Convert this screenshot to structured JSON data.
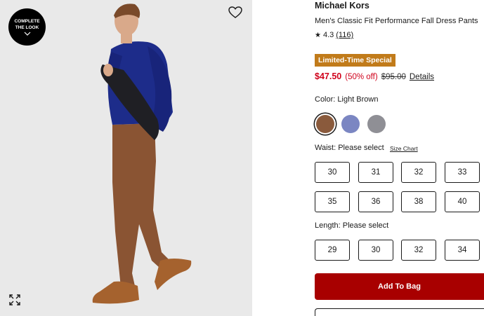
{
  "image": {
    "badge_line1": "COMPLETE",
    "badge_line2": "THE LOOK",
    "icons": [
      "chevron-down-icon",
      "heart-icon",
      "expand-icon"
    ]
  },
  "product": {
    "brand": "Michael Kors",
    "title": "Men's Classic Fit Performance Fall Dress Pants",
    "rating": "4.3",
    "review_count": "(116)",
    "special_badge": "Limited-Time Special",
    "price_now": "$47.50",
    "price_off": "(50% off)",
    "price_was": "$95.00",
    "details_link": "Details"
  },
  "color": {
    "label": "Color: Light Brown",
    "swatches": [
      {
        "name": "Light Brown",
        "hex": "#8a5a3c",
        "selected": true
      },
      {
        "name": "Blue",
        "hex": "#7b86c2",
        "selected": false
      },
      {
        "name": "Gray",
        "hex": "#8f8f95",
        "selected": false
      }
    ]
  },
  "waist": {
    "label": "Waist: Please select",
    "size_chart": "Size Chart",
    "options": [
      "30",
      "31",
      "32",
      "33",
      "35",
      "36",
      "38",
      "40"
    ]
  },
  "length": {
    "label": "Length: Please select",
    "options": [
      "29",
      "30",
      "32",
      "34"
    ]
  },
  "actions": {
    "add_to_bag": "Add To Bag"
  },
  "colors": {
    "accent_red": "#a80000",
    "price_red": "#d0021b",
    "special_bg": "#c17b1a"
  }
}
